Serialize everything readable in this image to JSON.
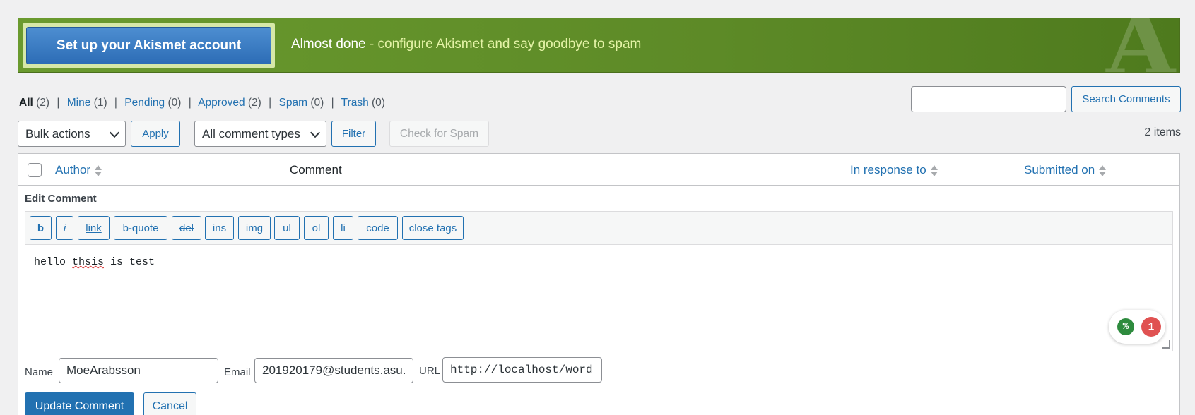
{
  "banner": {
    "button_label": "Set up your Akismet account",
    "lead": "Almost done",
    "rest": " - configure Akismet and say goodbye to spam",
    "logo": "A"
  },
  "filters": {
    "all": {
      "label": "All",
      "count": "(2)"
    },
    "mine": {
      "label": "Mine",
      "count": "(1)"
    },
    "pending": {
      "label": "Pending",
      "count": "(0)"
    },
    "approved": {
      "label": "Approved",
      "count": "(2)"
    },
    "spam": {
      "label": "Spam",
      "count": "(0)"
    },
    "trash": {
      "label": "Trash",
      "count": "(0)"
    },
    "separator": "|"
  },
  "search": {
    "value": "",
    "button_label": "Search Comments"
  },
  "toolbar": {
    "bulk_actions": "Bulk actions",
    "apply": "Apply",
    "comment_types": "All comment types",
    "filter": "Filter",
    "check_spam": "Check for Spam",
    "items": "2 items"
  },
  "table": {
    "columns": {
      "author": "Author",
      "comment": "Comment",
      "in_response_to": "In response to",
      "submitted_on": "Submitted on"
    }
  },
  "edit": {
    "title": "Edit Comment",
    "quicktags": [
      "b",
      "i",
      "link",
      "b-quote",
      "del",
      "ins",
      "img",
      "ul",
      "ol",
      "li",
      "code",
      "close tags"
    ],
    "content_pre": "hello ",
    "content_misspelled": "thsis",
    "content_post": " is test",
    "grammar_badge": "1",
    "grammar_icon": "%",
    "name_label": "Name",
    "name_value": "MoeArabsson",
    "email_label": "Email",
    "email_value": "201920179@students.asu.",
    "url_label": "URL",
    "url_value": "http://localhost/word",
    "update_label": "Update Comment",
    "cancel_label": "Cancel"
  },
  "colors": {
    "accent": "#2271b1",
    "banner": "#5d8a27",
    "badge": "#e05252"
  }
}
